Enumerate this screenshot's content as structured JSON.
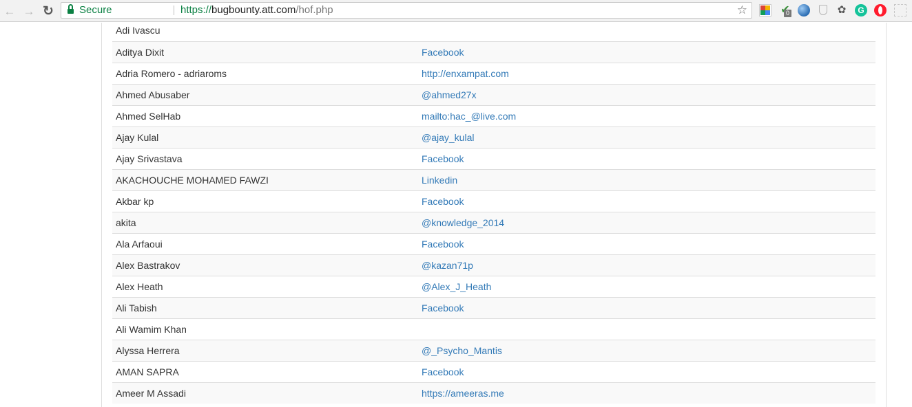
{
  "browser": {
    "secure_label": "Secure",
    "url": {
      "scheme": "https://",
      "host": "bugbounty.att.com",
      "path": "/hof.php"
    }
  },
  "colors": {
    "secure": "#0b8043",
    "link": "#337ab7",
    "text": "#333333",
    "stripe": "#f9f9f9"
  },
  "hall_of_fame": {
    "rows": [
      {
        "name": "Adi Ivascu",
        "link": ""
      },
      {
        "name": "Aditya Dixit",
        "link": "Facebook"
      },
      {
        "name": "Adria Romero - adriaroms",
        "link": "http://enxampat.com"
      },
      {
        "name": "Ahmed Abusaber",
        "link": "@ahmed27x"
      },
      {
        "name": "Ahmed SelHab",
        "link": "mailto:hac_@live.com"
      },
      {
        "name": "Ajay Kulal",
        "link": "@ajay_kulal"
      },
      {
        "name": "Ajay Srivastava",
        "link": "Facebook"
      },
      {
        "name": "AKACHOUCHE MOHAMED FAWZI",
        "link": "Linkedin"
      },
      {
        "name": "Akbar kp",
        "link": "Facebook"
      },
      {
        "name": "akita",
        "link": "@knowledge_2014"
      },
      {
        "name": "Ala Arfaoui",
        "link": "Facebook"
      },
      {
        "name": "Alex Bastrakov",
        "link": "@kazan71p"
      },
      {
        "name": "Alex Heath",
        "link": "@Alex_J_Heath"
      },
      {
        "name": "Ali Tabish",
        "link": "Facebook"
      },
      {
        "name": "Ali Wamim Khan",
        "link": ""
      },
      {
        "name": "Alyssa Herrera",
        "link": "@_Psycho_Mantis"
      },
      {
        "name": "AMAN SAPRA",
        "link": "Facebook"
      },
      {
        "name": "Ameer M Assadi",
        "link": "https://ameeras.me"
      }
    ]
  }
}
